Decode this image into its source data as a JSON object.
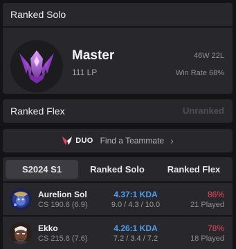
{
  "ranked_solo": {
    "title": "Ranked Solo",
    "tier": "Master",
    "lp": "111 LP",
    "record": "46W 22L",
    "win_rate": "Win Rate 68%",
    "emblem_icon": "master-emblem-icon"
  },
  "ranked_flex": {
    "title": "Ranked Flex",
    "status": "Unranked"
  },
  "duo": {
    "badge": "DUO",
    "label": "Find a Teammate",
    "icon": "chevron-right-icon"
  },
  "tabs": [
    {
      "label": "S2024 S1",
      "active": true
    },
    {
      "label": "Ranked Solo",
      "active": false
    },
    {
      "label": "Ranked Flex",
      "active": false
    }
  ],
  "champions": [
    {
      "name": "Aurelion Sol",
      "cs": "CS 190.8 (6.9)",
      "kda": "4.37:1 KDA",
      "kda_detail": "9.0 / 4.3 / 10.0",
      "win_pct": "86%",
      "played": "21 Played"
    },
    {
      "name": "Ekko",
      "cs": "CS 215.8 (7.6)",
      "kda": "4.26:1 KDA",
      "kda_detail": "7.2 / 3.4 / 7.2",
      "win_pct": "78%",
      "played": "18 Played"
    }
  ],
  "colors": {
    "background": "#141416",
    "card": "#28282c",
    "kda_blue": "#4c9ef0",
    "winrate_red": "#e8485a",
    "emblem_purple": "#b05ad8"
  }
}
